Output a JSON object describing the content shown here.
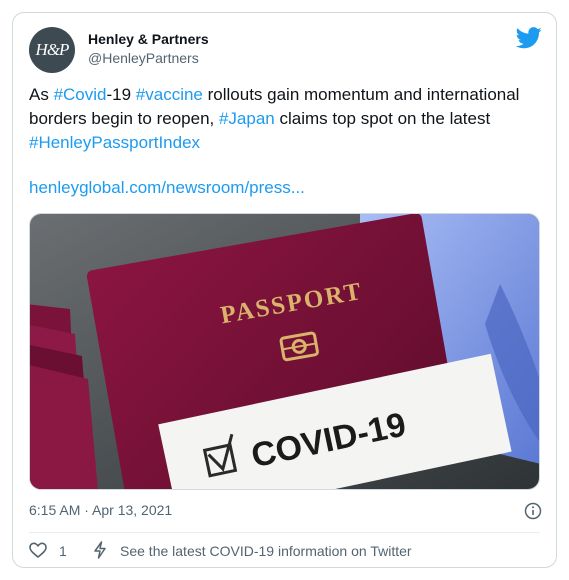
{
  "author": {
    "avatar_text": "H&P",
    "name": "Henley & Partners",
    "handle": "@HenleyPartners"
  },
  "tweet": {
    "text_parts": [
      {
        "text": "As ",
        "hashtag": false
      },
      {
        "text": "#Covid",
        "hashtag": true
      },
      {
        "text": "-19 ",
        "hashtag": false
      },
      {
        "text": "#vaccine",
        "hashtag": true
      },
      {
        "text": " rollouts gain momentum and international borders begin to reopen, ",
        "hashtag": false
      },
      {
        "text": "#Japan",
        "hashtag": true
      },
      {
        "text": " claims top spot on the latest ",
        "hashtag": false
      },
      {
        "text": "#HenleyPassportIndex",
        "hashtag": true
      }
    ],
    "link": "henleyglobal.com/newsroom/press..."
  },
  "media": {
    "passport_label": "PASSPORT",
    "covid_label": "COVID-19"
  },
  "meta": {
    "timestamp": "6:15 AM · Apr 13, 2021"
  },
  "actions": {
    "like_count": "1",
    "covid_info": "See the latest COVID-19 information on Twitter"
  },
  "colors": {
    "accent": "#1d9bf0",
    "muted": "#536471"
  }
}
